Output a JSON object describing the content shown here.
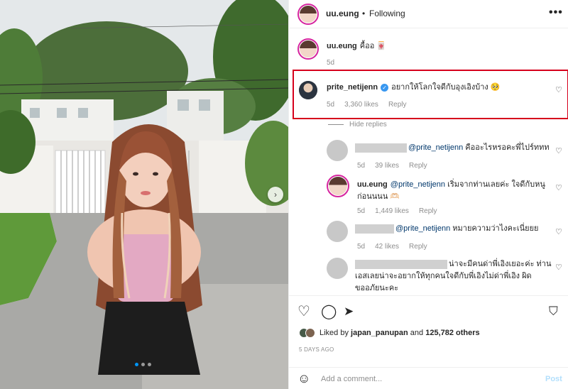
{
  "post": {
    "username": "uu.eung",
    "follow_state": "Following",
    "separator": "•",
    "more": "•••",
    "photo_alt": "Photo of a woman with long auburn hair standing in front of houses"
  },
  "caption": {
    "username": "uu.eung",
    "text": "คื้ออ 🀄",
    "age": "5d"
  },
  "comments": [
    {
      "username": "prite_netijenn",
      "verified": true,
      "text": "อยากให้โลกใจดีกับอุงเอิงบ้าง 🥺",
      "age": "5d",
      "likes": "3,360 likes",
      "reply": "Reply",
      "hide_replies": "Hide replies"
    }
  ],
  "replies": [
    {
      "mention": "@prite_netijenn",
      "text": "คืออะไรหรอคะพี่ไปร์ททท",
      "age": "5d",
      "likes": "39 likes",
      "reply": "Reply"
    },
    {
      "username": "uu.eung",
      "mention": "@prite_netijenn",
      "text_line1": "เริ่มจากท่านเลยค่ะ ใจดีกับหนู",
      "text_line2": "ก่อนนนน 🫶🏻",
      "age": "5d",
      "likes": "1,449 likes",
      "reply": "Reply"
    },
    {
      "mention": "@prite_netijenn",
      "text": "หมายความว่าไงคะเนี่ยยย",
      "age": "5d",
      "likes": "42 likes",
      "reply": "Reply"
    },
    {
      "text_line1": "น่าจะมีคนด่าพี่เอิงเยอะค่ะ ท่าน",
      "text_line2": "เอสเลยน่าจะอยากให้ทุกคนใจดีกับพี่เอิงไม่ด่าพี่เอิง ผิด",
      "text_line3": "ขออภัยนะคะ"
    }
  ],
  "likes": {
    "liked_by": "Liked by",
    "user": "japan_panupan",
    "and": "and",
    "others": "125,782 others"
  },
  "date": "5 DAYS AGO",
  "add_comment": {
    "placeholder": "Add a comment...",
    "post": "Post"
  },
  "icons": {
    "heart": "heart-icon",
    "comment": "comment-icon",
    "share": "share-icon",
    "save": "bookmark-icon",
    "emoji": "emoji-icon",
    "more": "more-icon",
    "chevron": "chevron-right-icon"
  },
  "colors": {
    "highlight_border": "#d6001c",
    "verified": "#3897f0",
    "mention": "#00376b",
    "meta": "#8e8e8e",
    "active_dot": "#0095f6"
  }
}
